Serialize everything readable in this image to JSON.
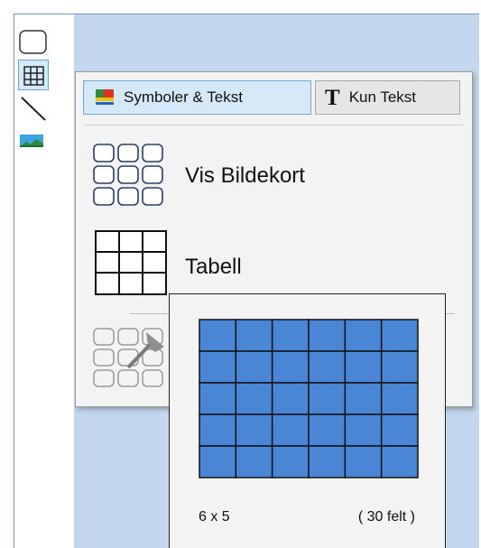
{
  "toolbar": {
    "tools": [
      {
        "name": "rectangle-tool",
        "icon": "rounded-rect-icon"
      },
      {
        "name": "table-tool",
        "icon": "grid-icon",
        "selected": true
      },
      {
        "name": "line-tool",
        "icon": "line-icon"
      },
      {
        "name": "image-tool",
        "icon": "image-icon"
      }
    ]
  },
  "dropdown": {
    "mode_symbols_label": "Symboler & Tekst",
    "mode_text_label": "Kun Tekst",
    "mode_text_glyph": "T",
    "items": [
      {
        "label": "Vis Bildekort",
        "icon": "card-grid-icon"
      },
      {
        "label": "Tabell",
        "icon": "table-icon"
      }
    ]
  },
  "table_popup": {
    "columns": 6,
    "rows": 5,
    "dims_label": "6 x 5",
    "count_label": "( 30 felt )"
  },
  "colors": {
    "canvas_bg": "#c3d7ef",
    "cell_fill": "#4a86d6",
    "selected_tool_bg": "#d6e9f8",
    "accent_border": "#5ea6dd"
  }
}
